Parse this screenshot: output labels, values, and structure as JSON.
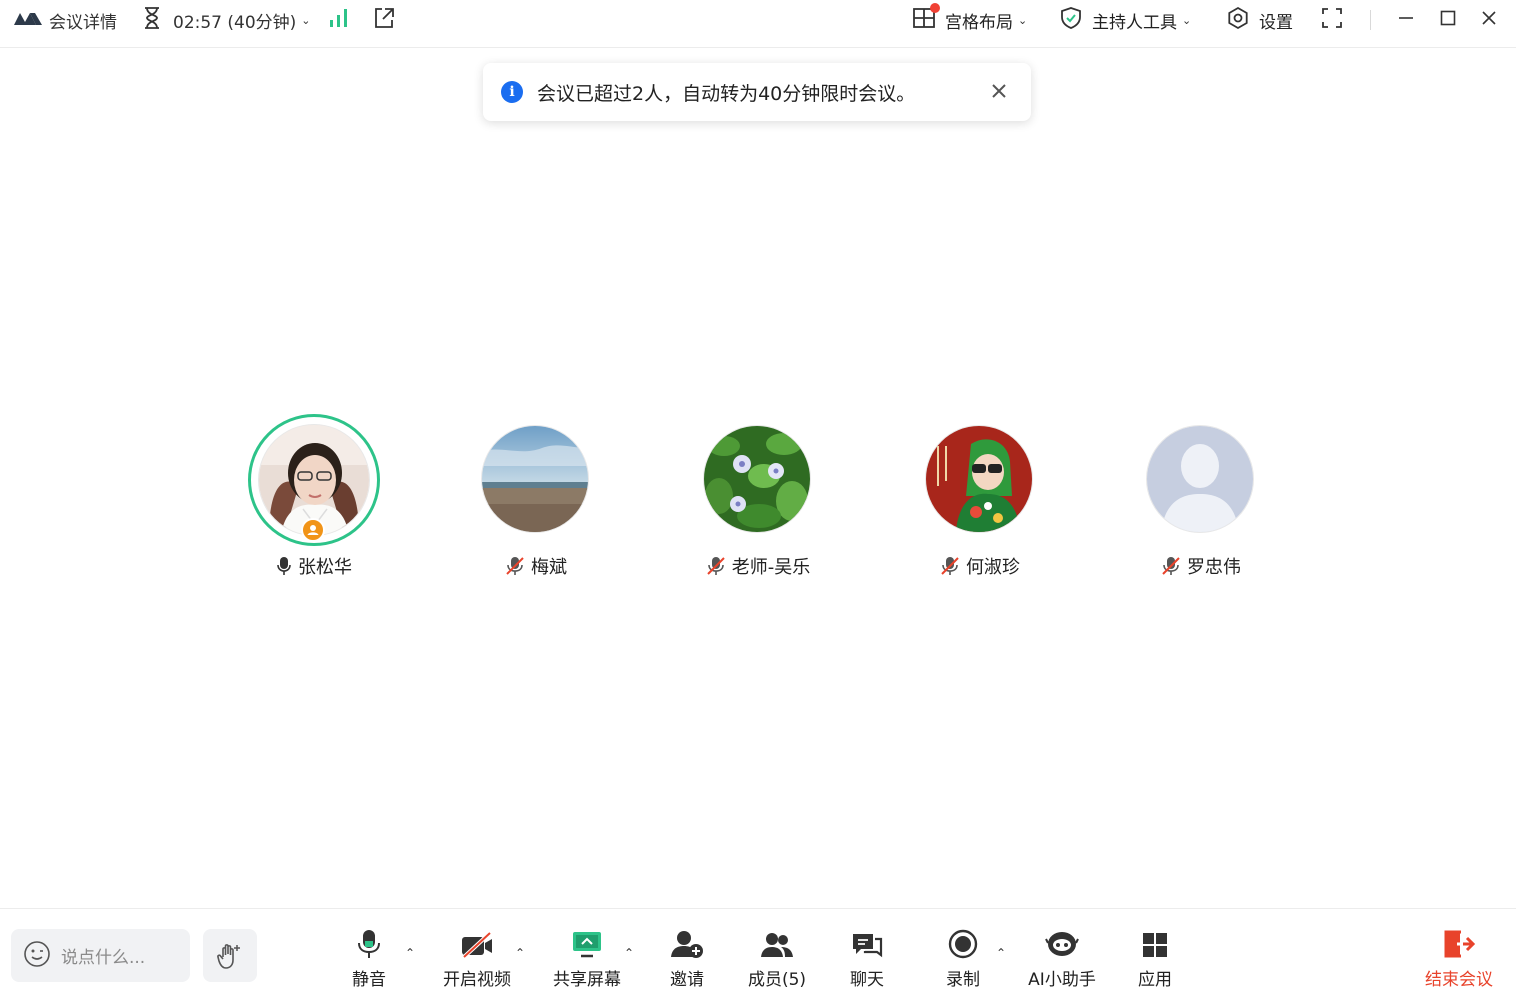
{
  "topbar": {
    "meeting_info_label": "会议详情",
    "timer": "02:57 (40分钟)",
    "layout_label": "宫格布局",
    "host_tools_label": "主持人工具",
    "settings_label": "设置"
  },
  "toast": {
    "message": "会议已超过2人，自动转为40分钟限时会议。"
  },
  "participants": [
    {
      "name": "张松华",
      "mic": "on",
      "host": true,
      "speaking": true
    },
    {
      "name": "梅斌",
      "mic": "muted"
    },
    {
      "name": "老师-吴乐",
      "mic": "muted"
    },
    {
      "name": "何淑珍",
      "mic": "muted"
    },
    {
      "name": "罗忠伟",
      "mic": "muted"
    }
  ],
  "bottombar": {
    "chat_placeholder": "说点什么...",
    "mute_label": "静音",
    "video_label": "开启视频",
    "share_label": "共享屏幕",
    "invite_label": "邀请",
    "members_label": "成员(5)",
    "chat_label": "聊天",
    "record_label": "录制",
    "ai_label": "AI小助手",
    "apps_label": "应用",
    "end_label": "结束会议"
  },
  "colors": {
    "accent_green": "#2dc389",
    "end_red": "#e8432b",
    "info_blue": "#1a6df0",
    "host_badge": "#f19418"
  }
}
